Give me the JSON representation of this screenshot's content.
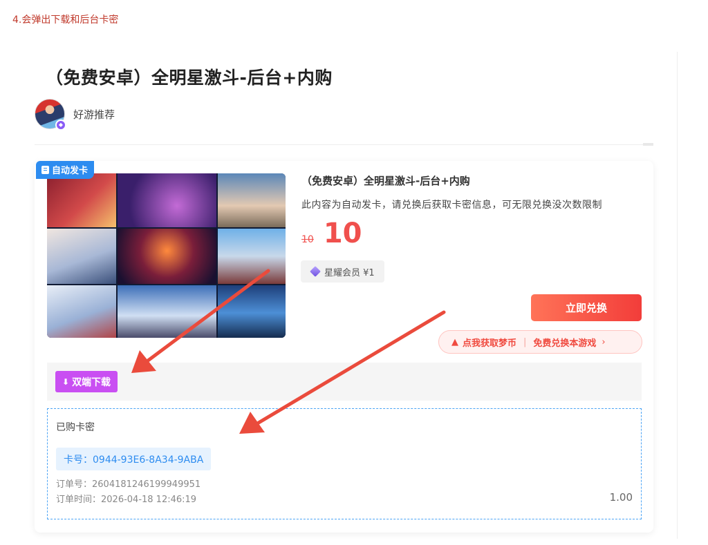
{
  "note": "4.会弹出下载和后台卡密",
  "post": {
    "title": "（免费安卓）全明星激斗-后台+内购",
    "author": "好游推荐"
  },
  "card": {
    "badge": "自动发卡",
    "product_title": "（免费安卓）全明星激斗-后台+内购",
    "description": "此内容为自动发卡，请兑换后获取卡密信息，可无限兑换没次数限制",
    "price_old": "10",
    "price_now": "10",
    "vip_label": "星耀会员 ¥1",
    "buy_label": "立即兑换",
    "coin_left": "点我获取梦币",
    "coin_sep": "|",
    "coin_right": "免费兑换本游戏",
    "coin_chevron": "›",
    "download_label": "双端下载"
  },
  "keys": {
    "title": "已购卡密",
    "card_no": "卡号：0944-93E6-8A34-9ABA",
    "order_no": "订单号：2604181246199949951",
    "order_time": "订单时间：2026-04-18 12:46:19",
    "amount": "1.00"
  },
  "icons": {
    "badge": "book-icon",
    "vip": "diamond-icon",
    "coin": "rocket-icon",
    "download": "download-icon"
  },
  "colors": {
    "accent_red": "#f0504d",
    "blue": "#2d8cf0",
    "purple": "#c94ff2",
    "annotation_arrow": "#ea4b3c"
  }
}
